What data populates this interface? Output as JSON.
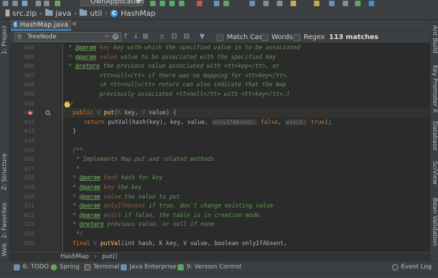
{
  "toolbar": {
    "run_config": "OwnApplication"
  },
  "navbar": {
    "crumbs": [
      "src.zip",
      "java",
      "util",
      "HashMap"
    ]
  },
  "tabs": [
    {
      "label": "HashMap.java"
    }
  ],
  "search": {
    "query": "TreeNode",
    "options": {
      "match_case": "Match Case",
      "words": "Words",
      "regex": "Regex"
    },
    "matches": "113 matches"
  },
  "editor": {
    "line_numbers": [
      "604",
      "605",
      "606",
      "607",
      "608",
      "609",
      "610",
      "611",
      "612",
      "613",
      "614",
      "615",
      "616",
      "617",
      "618",
      "619",
      "620",
      "621",
      "622",
      "623",
      "624",
      "625"
    ],
    "lines": {
      "l604_tag": "@param",
      "l604_pn": "key",
      "l604_rest": " key with which the specified value is to be associated",
      "l605_tag": "@param",
      "l605_pn": "value",
      "l605_rest": " value to be associated with the specified key",
      "l606_tag": "@return",
      "l606_rest": " the previous value associated with <tt>key</tt>, or",
      "l607": "         <tt>null</tt> if there was no mapping for <tt>key</tt>.",
      "l608": "         (A <tt>null</tt> return can also indicate that the map",
      "l609": "         previously associated <tt>null</tt> with <tt>key</tt>.)",
      "l610": " */",
      "l611_public": "public ",
      "l611_v": "V ",
      "l611_put": "put",
      "l611_open": "(",
      "l611_k": "K",
      "l611_key": " key, ",
      "l611_v2": "V",
      "l611_close": " value) {",
      "l612_ret": "return ",
      "l612_call": "putVal(",
      "l612_hash": "hash",
      "l612_args": "(key), key, value, ",
      "l612_hint1": "onlyIfAbsent:",
      "l612_false": " false",
      "l612_comma": ", ",
      "l612_hint2": "evict:",
      "l612_true": " true",
      "l612_end": ");",
      "l613": "}",
      "l615": "/**",
      "l616": " * Implements Map.put and related methods",
      "l617": " *",
      "l618_tag": "@param",
      "l618_pn": "hash",
      "l618_rest": " hash for key",
      "l619_tag": "@param",
      "l619_pn": "key",
      "l619_rest": " the key",
      "l620_tag": "@param",
      "l620_pn": "value",
      "l620_rest": " the value to put",
      "l621_tag": "@param",
      "l621_pn": "onlyIfAbsent",
      "l621_rest": " if true, don't change existing value",
      "l622_tag": "@param",
      "l622_pn": "evict",
      "l622_rest": " if false, the table is in creation mode.",
      "l623_tag": "@return",
      "l623_rest": " previous value, or null if none",
      "l624": " */",
      "l625_final": "final ",
      "l625_v": "V ",
      "l625_fn": "putVal",
      "l625_rest": "(int hash, K key, V value, boolean onlyIfAbsent,"
    }
  },
  "editor_breadcrumb": {
    "cls": "HashMap",
    "method": "put()"
  },
  "left_tabs": {
    "project": "1: Project",
    "structure": "Z: Structure",
    "favorites": "2: Favorites",
    "web": "Web"
  },
  "right_tabs": [
    "Ant Build",
    "Key Promoter X",
    "Database",
    "SciView",
    "Bean Validation"
  ],
  "bottom_tabs": {
    "todo": "6: TODO",
    "spring": "Spring",
    "terminal": "Terminal",
    "java_enterprise": "Java Enterprise",
    "vcs": "9: Version Control",
    "event_log": "Event Log"
  },
  "colors": {
    "accent": "#4a88c7",
    "comment": "#629755",
    "keyword": "#cc7832",
    "method": "#ffc66d"
  }
}
